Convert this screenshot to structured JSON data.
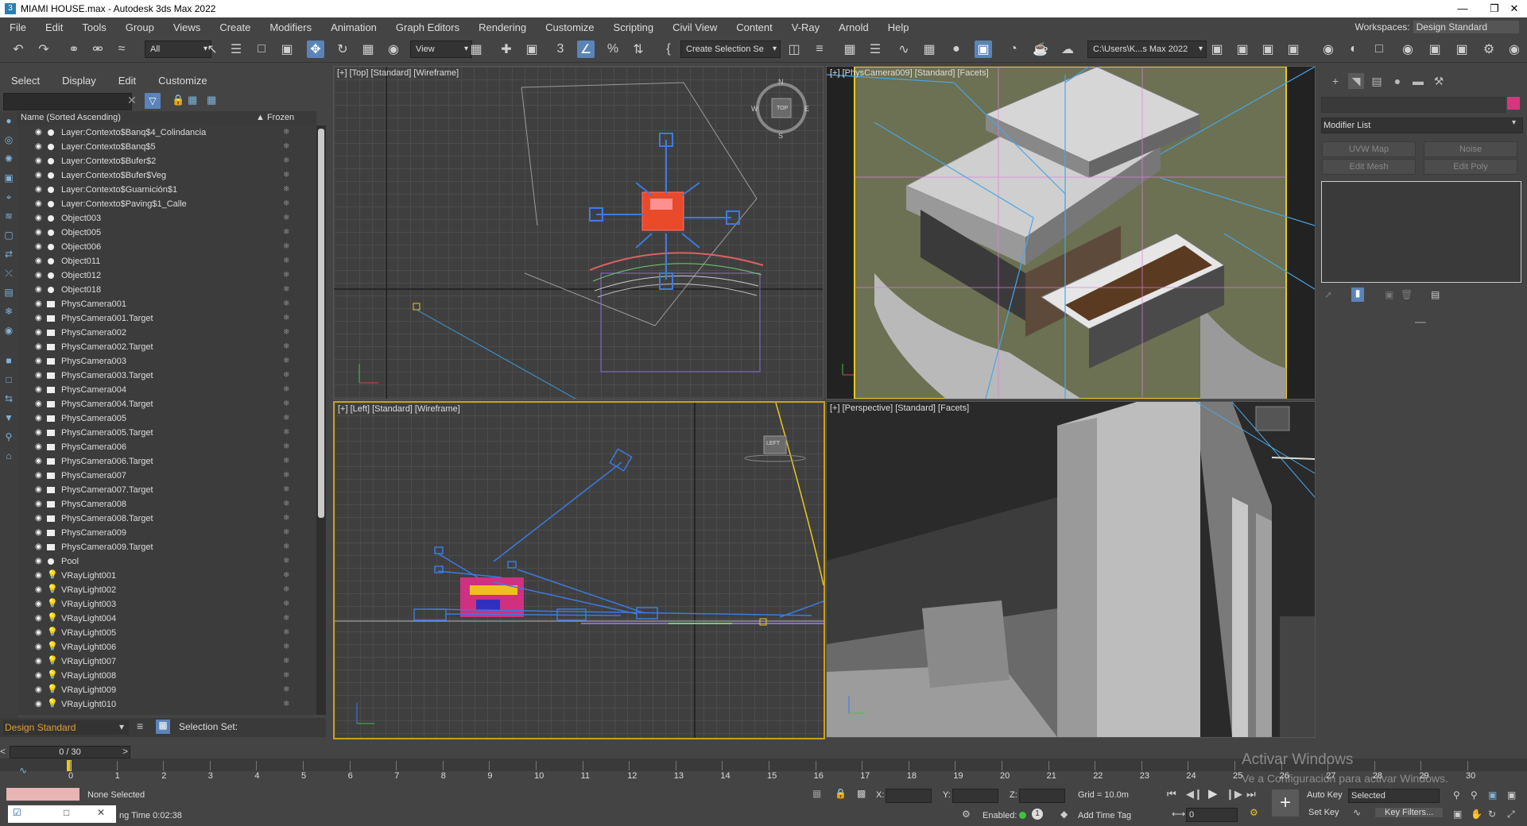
{
  "window": {
    "title": "MIAMI HOUSE.max - Autodesk 3ds Max 2022"
  },
  "menu": [
    "File",
    "Edit",
    "Tools",
    "Group",
    "Views",
    "Create",
    "Modifiers",
    "Animation",
    "Graph Editors",
    "Rendering",
    "Customize",
    "Scripting",
    "Civil View",
    "Content",
    "V-Ray",
    "Arnold",
    "Help"
  ],
  "workspace": {
    "label": "Workspaces:",
    "value": "Design Standard"
  },
  "toolbar": {
    "filter": "All",
    "view": "View",
    "selection_set": "Create Selection Se",
    "path": "C:\\Users\\K...s Max 2022"
  },
  "scene_explorer": {
    "menu": [
      "Select",
      "Display",
      "Edit",
      "Customize"
    ],
    "col_name": "Name (Sorted Ascending)",
    "col_frozen": "▲ Frozen",
    "items": [
      {
        "name": "Layer:Contexto$Banq$4_Colindancia",
        "type": "dot"
      },
      {
        "name": "Layer:Contexto$Banq$5",
        "type": "dot"
      },
      {
        "name": "Layer:Contexto$Bufer$2",
        "type": "dot"
      },
      {
        "name": "Layer:Contexto$Bufer$Veg",
        "type": "dot"
      },
      {
        "name": "Layer:Contexto$Guarnición$1",
        "type": "dot"
      },
      {
        "name": "Layer:Contexto$Paving$1_Calle",
        "type": "dot"
      },
      {
        "name": "Object003",
        "type": "dot"
      },
      {
        "name": "Object005",
        "type": "dot"
      },
      {
        "name": "Object006",
        "type": "dot"
      },
      {
        "name": "Object011",
        "type": "dot"
      },
      {
        "name": "Object012",
        "type": "dot"
      },
      {
        "name": "Object018",
        "type": "dot"
      },
      {
        "name": "PhysCamera001",
        "type": "cam"
      },
      {
        "name": "PhysCamera001.Target",
        "type": "cam"
      },
      {
        "name": "PhysCamera002",
        "type": "cam"
      },
      {
        "name": "PhysCamera002.Target",
        "type": "cam"
      },
      {
        "name": "PhysCamera003",
        "type": "cam"
      },
      {
        "name": "PhysCamera003.Target",
        "type": "cam"
      },
      {
        "name": "PhysCamera004",
        "type": "cam"
      },
      {
        "name": "PhysCamera004.Target",
        "type": "cam"
      },
      {
        "name": "PhysCamera005",
        "type": "cam"
      },
      {
        "name": "PhysCamera005.Target",
        "type": "cam"
      },
      {
        "name": "PhysCamera006",
        "type": "cam"
      },
      {
        "name": "PhysCamera006.Target",
        "type": "cam"
      },
      {
        "name": "PhysCamera007",
        "type": "cam"
      },
      {
        "name": "PhysCamera007.Target",
        "type": "cam"
      },
      {
        "name": "PhysCamera008",
        "type": "cam"
      },
      {
        "name": "PhysCamera008.Target",
        "type": "cam"
      },
      {
        "name": "PhysCamera009",
        "type": "cam"
      },
      {
        "name": "PhysCamera009.Target",
        "type": "cam"
      },
      {
        "name": "Pool",
        "type": "dot"
      },
      {
        "name": "VRayLight001",
        "type": "bulb"
      },
      {
        "name": "VRayLight002",
        "type": "bulb"
      },
      {
        "name": "VRayLight003",
        "type": "bulb"
      },
      {
        "name": "VRayLight004",
        "type": "bulb"
      },
      {
        "name": "VRayLight005",
        "type": "bulb"
      },
      {
        "name": "VRayLight006",
        "type": "bulb"
      },
      {
        "name": "VRayLight007",
        "type": "bulb"
      },
      {
        "name": "VRayLight008",
        "type": "bulb"
      },
      {
        "name": "VRayLight009",
        "type": "bulb"
      },
      {
        "name": "VRayLight010",
        "type": "bulb"
      }
    ],
    "layer_dropdown": "Design Standard",
    "selection_set_label": "Selection Set:"
  },
  "viewports": {
    "top": "[+] [Top] [Standard] [Wireframe]",
    "camera": "[+] [PhysCamera009] [Standard] [Facets]",
    "left": "[+] [Left] [Standard] [Wireframe]",
    "perspective": "[+] [Perspective] [Standard] [Facets]",
    "viewcube_top": "TOP",
    "viewcube_left": "LEFT",
    "compass": {
      "n": "N",
      "s": "S",
      "e": "E",
      "w": "W"
    }
  },
  "command_panel": {
    "modifier_list": "Modifier List",
    "buttons": [
      "UVW Map",
      "Noise",
      "Edit Mesh",
      "Edit Poly"
    ]
  },
  "timeline": {
    "slider": "0 / 30",
    "ticks": [
      "0",
      "1",
      "2",
      "3",
      "4",
      "5",
      "6",
      "7",
      "8",
      "9",
      "10",
      "11",
      "12",
      "13",
      "14",
      "15",
      "16",
      "17",
      "18",
      "19",
      "20",
      "21",
      "22",
      "23",
      "24",
      "25",
      "26",
      "27",
      "28",
      "29",
      "30"
    ]
  },
  "status": {
    "selection": "None Selected",
    "time": "ng Time  0:02:38",
    "x_label": "X:",
    "y_label": "Y:",
    "z_label": "Z:",
    "grid": "Grid = 10.0m",
    "enabled": "Enabled:",
    "add_time_tag": "Add Time Tag",
    "auto_key": "Auto Key",
    "set_key": "Set Key",
    "selected": "Selected",
    "key_filters": "Key Filters...",
    "frame": "0"
  },
  "watermark": {
    "line1": "Activar Windows",
    "line2": "Ve a Configuración para activar Windows."
  }
}
